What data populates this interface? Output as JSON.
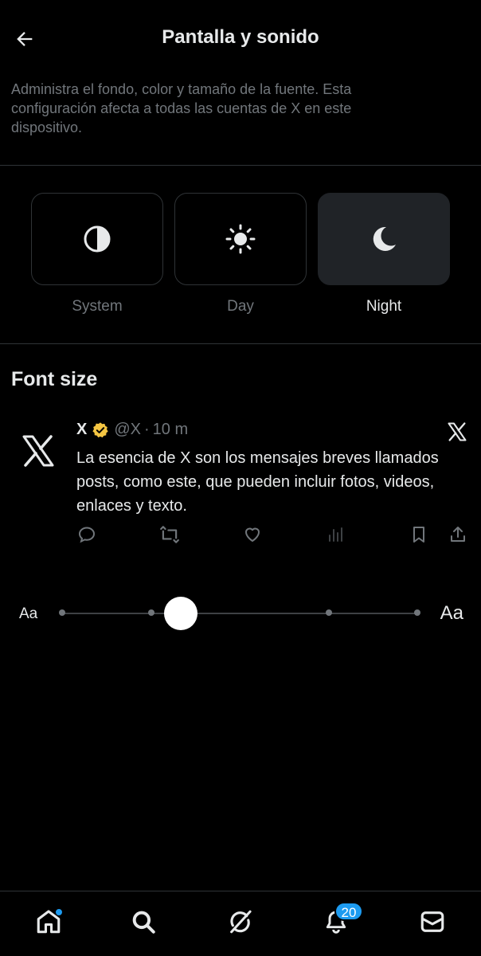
{
  "header": {
    "title": "Pantalla y sonido"
  },
  "description": "Administra el fondo, color y tamaño de la fuente. Esta configuración afecta a todas las cuentas de X en este dispositivo.",
  "themes": [
    {
      "label": "System",
      "icon": "half-circle-icon",
      "active": false
    },
    {
      "label": "Day",
      "icon": "sun-icon",
      "active": false
    },
    {
      "label": "Night",
      "icon": "moon-icon",
      "active": true
    }
  ],
  "font_size": {
    "title": "Font size",
    "small_label": "Aa",
    "large_label": "Aa",
    "steps": 5,
    "selected_step": 2
  },
  "post": {
    "name": "X",
    "handle": "@X",
    "separator": "·",
    "time": "10 m",
    "text": "La esencia de X son los mensajes breves llamados posts, como este, que pueden incluir fotos, videos, enlaces y texto.",
    "actions": [
      "reply-icon",
      "repost-icon",
      "like-icon",
      "views-icon",
      "bookmark-icon",
      "share-icon"
    ]
  },
  "nav": {
    "items": [
      "home-icon",
      "search-icon",
      "grok-icon",
      "notifications-icon",
      "messages-icon"
    ],
    "notifications_count": "20"
  },
  "colors": {
    "accent": "#1d9bf0",
    "verified": "#f4c542",
    "background": "#000000",
    "muted": "#71767b"
  }
}
